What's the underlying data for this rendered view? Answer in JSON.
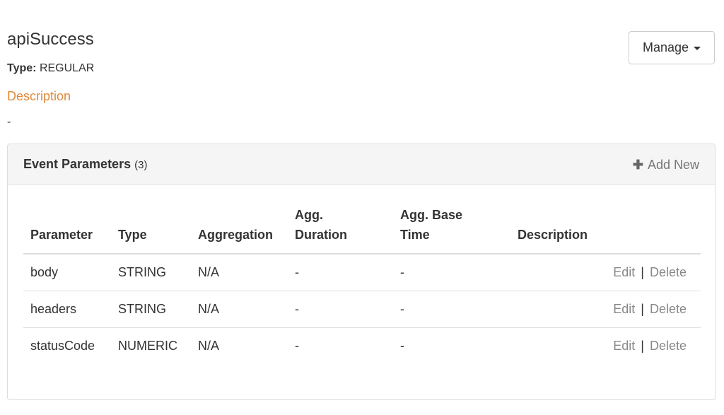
{
  "event": {
    "name": "apiSuccess",
    "type_label": "Type:",
    "type_value": "REGULAR",
    "description_heading": "Description",
    "description_value": "-"
  },
  "manage": {
    "label": "Manage"
  },
  "panel": {
    "title": "Event Parameters",
    "count": "(3)",
    "add_new_label": "Add New"
  },
  "table": {
    "headers": {
      "parameter": "Parameter",
      "type": "Type",
      "aggregation": "Aggregation",
      "agg_duration_1": "Agg.",
      "agg_duration_2": "Duration",
      "agg_base_time_1": "Agg. Base",
      "agg_base_time_2": "Time",
      "description": "Description"
    },
    "rows": [
      {
        "parameter": "body",
        "type": "STRING",
        "aggregation": "N/A",
        "agg_duration": "-",
        "agg_base_time": "-",
        "description": "",
        "edit": "Edit",
        "delete": "Delete"
      },
      {
        "parameter": "headers",
        "type": "STRING",
        "aggregation": "N/A",
        "agg_duration": "-",
        "agg_base_time": "-",
        "description": "",
        "edit": "Edit",
        "delete": "Delete"
      },
      {
        "parameter": "statusCode",
        "type": "NUMERIC",
        "aggregation": "N/A",
        "agg_duration": "-",
        "agg_base_time": "-",
        "description": "",
        "edit": "Edit",
        "delete": "Delete"
      }
    ],
    "separator": "|"
  },
  "colors": {
    "accent": "#e08a3c",
    "link_muted": "#888888",
    "border": "#dddddd",
    "panel_bg": "#f5f5f5"
  },
  "icons": {
    "plus": "plus-icon",
    "caret": "caret-down-icon"
  }
}
